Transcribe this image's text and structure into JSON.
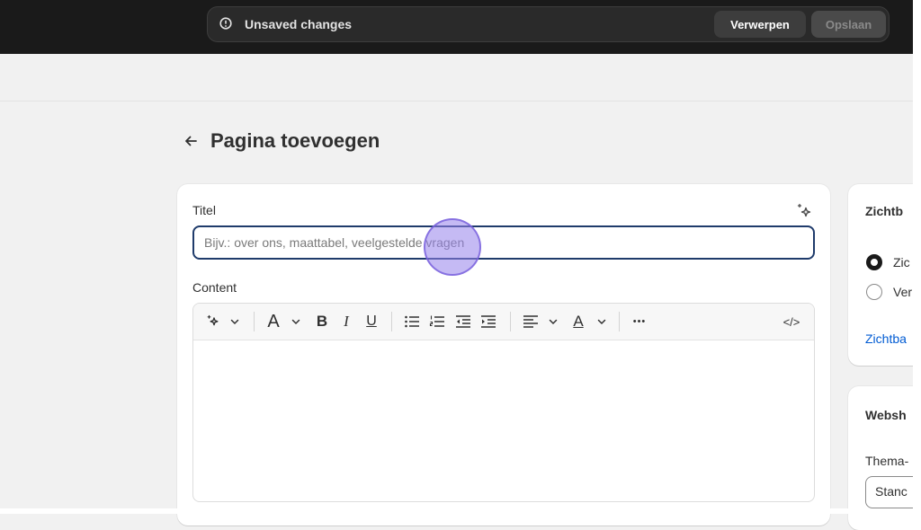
{
  "context_bar": {
    "message": "Unsaved changes",
    "discard_label": "Verwerpen",
    "save_label": "Opslaan"
  },
  "page": {
    "title": "Pagina toevoegen"
  },
  "form": {
    "title_label": "Titel",
    "title_value": "",
    "title_placeholder": "Bijv.: over ons, maattabel, veelgestelde vragen",
    "content_label": "Content"
  },
  "toolbar": {
    "icons": [
      "magic-icon",
      "chevron-down-icon",
      "text-style-icon",
      "chevron-down-icon",
      "bold-icon",
      "italic-icon",
      "underline-icon",
      "bullet-list-icon",
      "numbered-list-icon",
      "outdent-icon",
      "indent-icon",
      "align-icon",
      "chevron-down-icon",
      "text-color-icon",
      "chevron-down-icon",
      "more-icon",
      "code-icon"
    ],
    "text_style_glyph": "A",
    "bold_glyph": "B",
    "italic_glyph": "I",
    "underline_glyph": "U",
    "text_color_glyph": "A",
    "more_glyph": "•••",
    "code_glyph": "</>"
  },
  "visibility_card": {
    "heading": "Zichtb",
    "options": [
      {
        "label": "Zic",
        "selected": true
      },
      {
        "label": "Ver",
        "selected": false
      }
    ],
    "link": "Zichtba"
  },
  "webshop_card": {
    "heading": "Websh",
    "theme_label": "Thema-",
    "theme_value": "Stanc"
  },
  "colors": {
    "accent_link": "#005bd3",
    "focus_border": "#1f3b6b",
    "topbar": "#1a1a1a"
  }
}
